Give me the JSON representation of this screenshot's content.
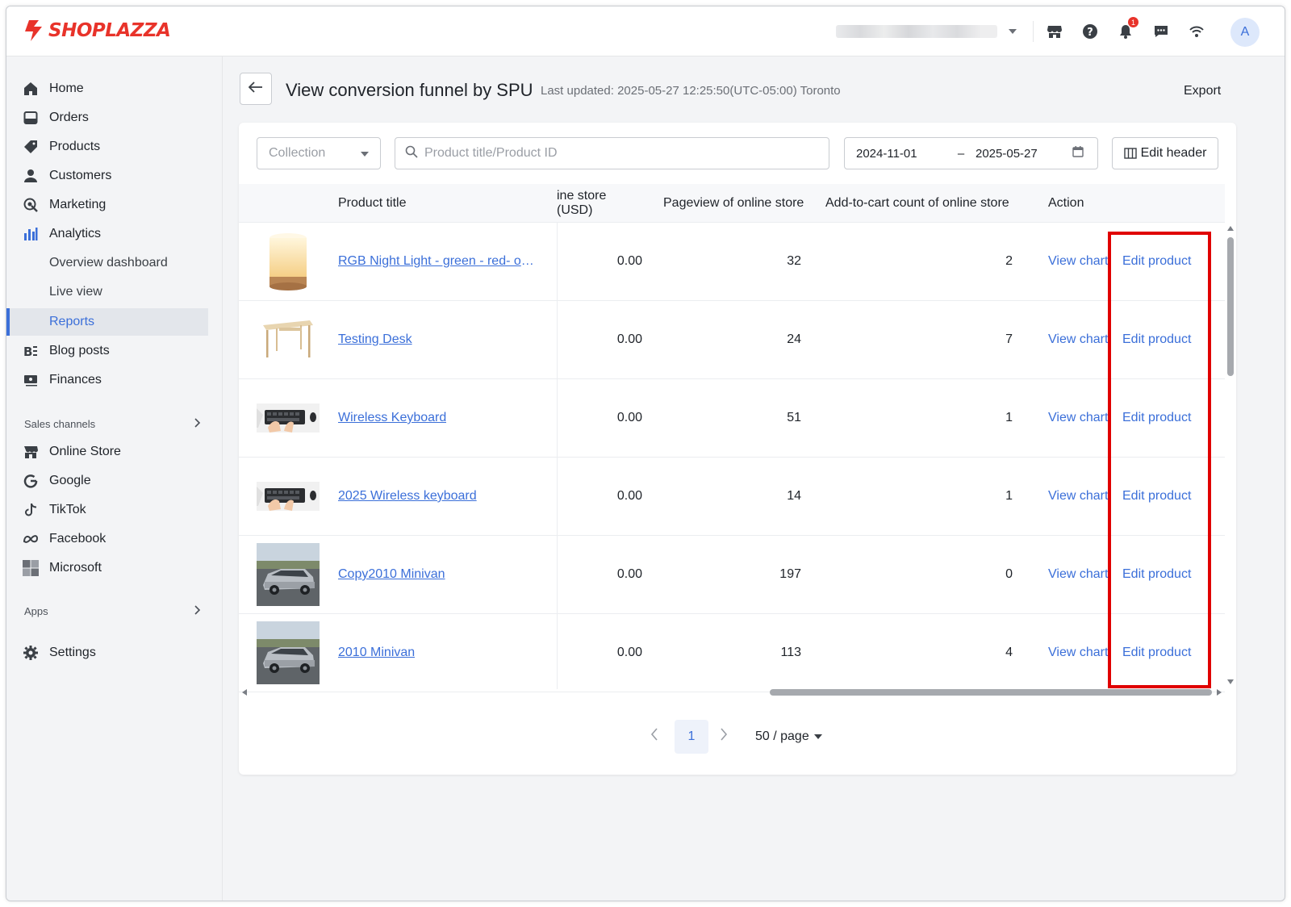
{
  "app": {
    "logo_text": "SHOPLAZZA",
    "brand_color": "#e8332a",
    "accent_color": "#3b6fd9"
  },
  "topbar": {
    "notification_count": "1",
    "avatar_letter": "A",
    "icons": [
      "store-icon",
      "help-icon",
      "bell-icon",
      "chat-icon",
      "wifi-icon"
    ]
  },
  "sidebar": {
    "items": [
      {
        "label": "Home",
        "icon": "home-icon"
      },
      {
        "label": "Orders",
        "icon": "orders-icon"
      },
      {
        "label": "Products",
        "icon": "tag-icon"
      },
      {
        "label": "Customers",
        "icon": "person-icon"
      },
      {
        "label": "Marketing",
        "icon": "marketing-icon"
      },
      {
        "label": "Analytics",
        "icon": "bar-chart-icon"
      }
    ],
    "analytics_sub": [
      "Overview dashboard",
      "Live view",
      "Reports"
    ],
    "items2": [
      {
        "label": "Blog posts",
        "icon": "blog-icon"
      },
      {
        "label": "Finances",
        "icon": "finance-icon"
      }
    ],
    "sales_channels_label": "Sales channels",
    "channels": [
      {
        "label": "Online Store",
        "icon": "store-icon"
      },
      {
        "label": "Google",
        "icon": "google-icon"
      },
      {
        "label": "TikTok",
        "icon": "tiktok-icon"
      },
      {
        "label": "Facebook",
        "icon": "meta-icon"
      },
      {
        "label": "Microsoft",
        "icon": "microsoft-icon"
      }
    ],
    "apps_label": "Apps",
    "settings_label": "Settings"
  },
  "page": {
    "title": "View conversion funnel by SPU",
    "last_updated": "Last updated: 2025-05-27 12:25:50(UTC-05:00) Toronto",
    "export_label": "Export"
  },
  "filters": {
    "collection_placeholder": "Collection",
    "search_placeholder": "Product title/Product ID",
    "date_start": "2024-11-01",
    "date_sep": "–",
    "date_end": "2025-05-27",
    "edit_header_label": "Edit header"
  },
  "table": {
    "headers": {
      "product_title": "Product title",
      "sales": "ine store (USD)",
      "pageview": "Pageview of online store",
      "add_to_cart": "Add-to-cart count of online store",
      "action": "Action"
    },
    "rows": [
      {
        "title": "RGB Night Light - green - red- ora...",
        "sales": "0.00",
        "pageview": "32",
        "atc": "2",
        "view": "View chart",
        "edit": "Edit product",
        "thumb": "lamp"
      },
      {
        "title": "Testing Desk",
        "sales": "0.00",
        "pageview": "24",
        "atc": "7",
        "view": "View chart",
        "edit": "Edit product",
        "thumb": "desk"
      },
      {
        "title": "Wireless Keyboard",
        "sales": "0.00",
        "pageview": "51",
        "atc": "1",
        "view": "View chart",
        "edit": "Edit product",
        "thumb": "keyboard"
      },
      {
        "title": "2025 Wireless keyboard",
        "sales": "0.00",
        "pageview": "14",
        "atc": "1",
        "view": "View chart",
        "edit": "Edit product",
        "thumb": "keyboard"
      },
      {
        "title": "Copy2010 Minivan",
        "sales": "0.00",
        "pageview": "197",
        "atc": "0",
        "view": "View chart",
        "edit": "Edit product",
        "thumb": "car"
      },
      {
        "title": "2010 Minivan",
        "sales": "0.00",
        "pageview": "113",
        "atc": "4",
        "view": "View chart",
        "edit": "Edit product",
        "thumb": "car"
      }
    ]
  },
  "pagination": {
    "current": "1",
    "page_size": "50 / page"
  }
}
